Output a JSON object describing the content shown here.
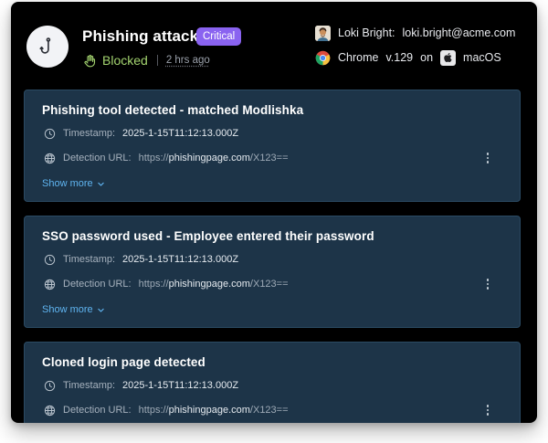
{
  "incident": {
    "title": "Phishing attack",
    "severity": "Critical",
    "status": "Blocked",
    "time_ago": "2 hrs ago"
  },
  "user": {
    "name": "Loki Bright:",
    "email": "loki.bright@acme.com"
  },
  "environment": {
    "browser": "Chrome",
    "version": "v.129",
    "connector": "on",
    "os": "macOS"
  },
  "labels": {
    "timestamp": "Timestamp:",
    "detection_url": "Detection URL:",
    "show_more": "Show more"
  },
  "detections": [
    {
      "title": "Phishing tool detected - matched Modlishka",
      "timestamp": "2025-1-15T11:12:13.000Z",
      "url_scheme": "https://",
      "url_host": "phishingpage.com",
      "url_path": "/X123=="
    },
    {
      "title": "SSO password used - Employee entered their password",
      "timestamp": "2025-1-15T11:12:13.000Z",
      "url_scheme": "https://",
      "url_host": "phishingpage.com",
      "url_path": "/X123=="
    },
    {
      "title": "Cloned login page detected",
      "timestamp": "2025-1-15T11:12:13.000Z",
      "url_scheme": "https://",
      "url_host": "phishingpage.com",
      "url_path": "/X123=="
    }
  ],
  "colors": {
    "panel_bg": "#000000",
    "card_bg": "#1d3448",
    "badge": "#8a63f0",
    "blocked": "#a3d36f",
    "link": "#5fb4f0"
  },
  "icons": {
    "incident": "hook-icon",
    "status": "hand-icon",
    "browser": "chrome-icon",
    "os": "apple-icon",
    "timestamp": "clock-icon",
    "url": "globe-icon",
    "menu": "kebab-menu-icon",
    "expand": "chevron-down-icon"
  }
}
